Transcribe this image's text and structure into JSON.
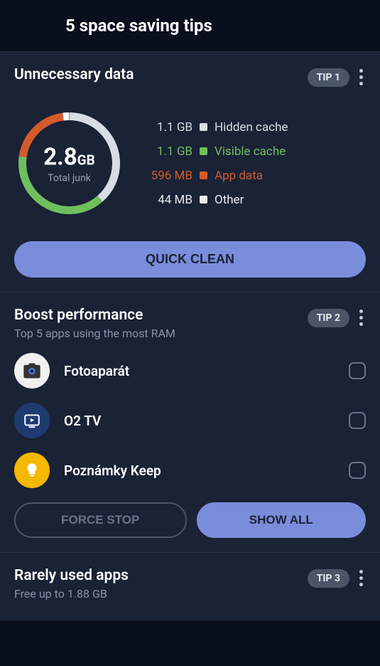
{
  "header": {
    "title": "5 space saving tips"
  },
  "tip1": {
    "title": "Unnecessary data",
    "badge": "TIP 1",
    "donut_value": "2.8",
    "donut_unit": "GB",
    "donut_label": "Total junk",
    "legend": [
      {
        "size": "1.1 GB",
        "label": "Hidden cache"
      },
      {
        "size": "1.1 GB",
        "label": "Visible cache"
      },
      {
        "size": "596 MB",
        "label": "App data"
      },
      {
        "size": "44 MB",
        "label": "Other"
      }
    ],
    "cta": "QUICK CLEAN"
  },
  "tip2": {
    "title": "Boost performance",
    "subtitle": "Top 5 apps using the most RAM",
    "badge": "TIP 2",
    "apps": [
      {
        "name": "Fotoaparát"
      },
      {
        "name": "O2 TV"
      },
      {
        "name": "Poznámky Keep"
      }
    ],
    "force_stop": "FORCE STOP",
    "show_all": "SHOW ALL"
  },
  "tip3": {
    "title": "Rarely used apps",
    "subtitle": "Free up to 1.88 GB",
    "badge": "TIP 3"
  },
  "chart_data": {
    "type": "pie",
    "title": "Total junk 2.8 GB",
    "series": [
      {
        "name": "Hidden cache",
        "value_gb": 1.1,
        "color": "#d8dce5"
      },
      {
        "name": "Visible cache",
        "value_gb": 1.1,
        "color": "#6fbf5e"
      },
      {
        "name": "App data",
        "value_gb": 0.596,
        "color": "#d45a2c"
      },
      {
        "name": "Other",
        "value_gb": 0.044,
        "color": "#e8ebf0"
      }
    ]
  }
}
